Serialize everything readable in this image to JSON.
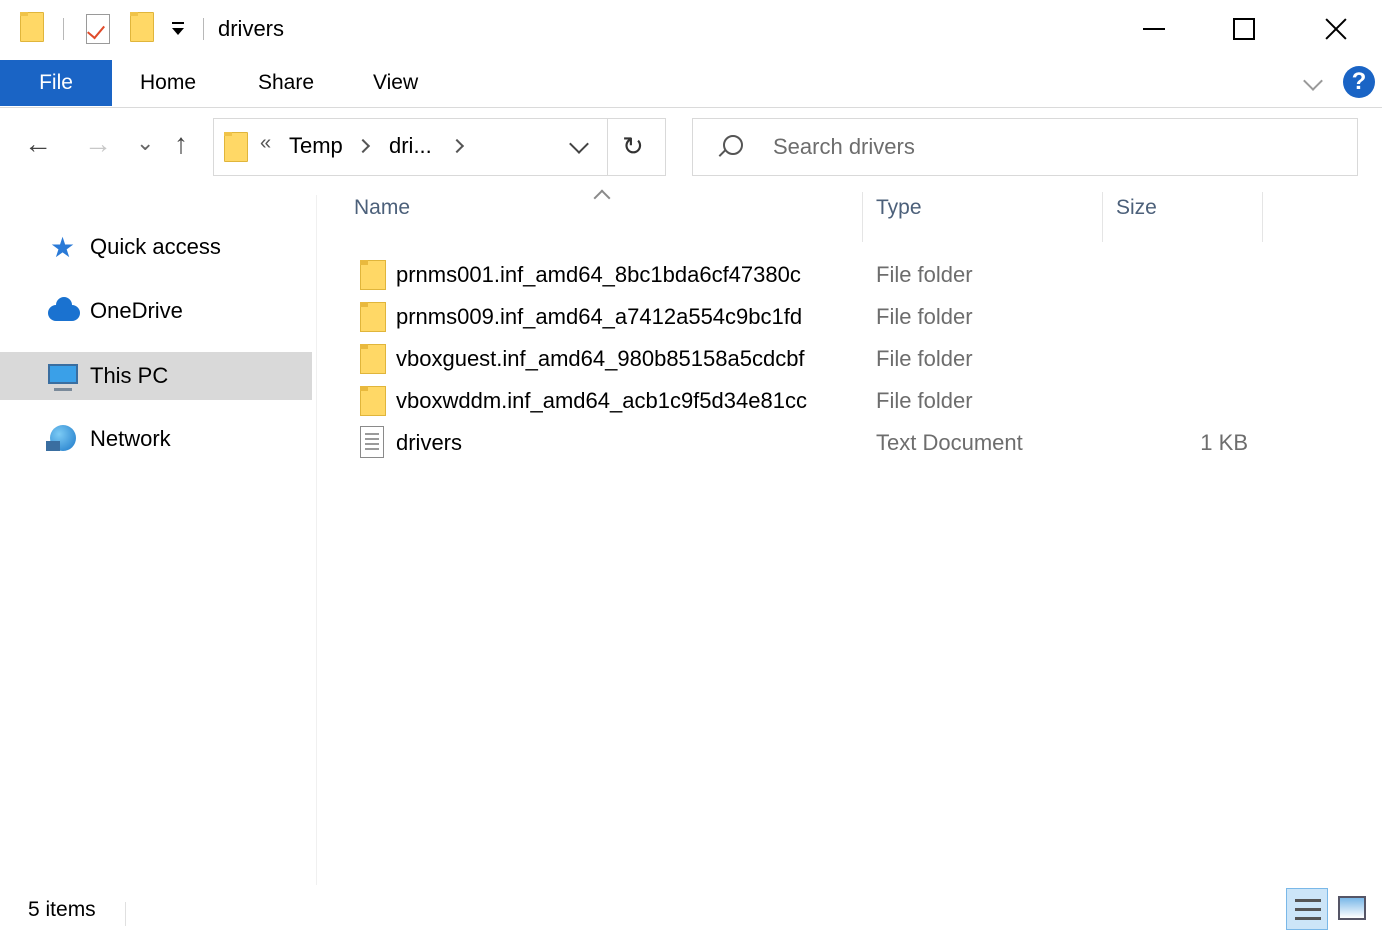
{
  "window": {
    "title": "drivers"
  },
  "ribbon": {
    "tabs": [
      "File",
      "Home",
      "Share",
      "View"
    ],
    "help_label": "?"
  },
  "address": {
    "overflow": "«",
    "segments": [
      "Temp",
      "dri..."
    ],
    "refresh_glyph": "↻"
  },
  "nav_buttons": {
    "back": "←",
    "forward": "→",
    "recent": "⌄",
    "up": "↑"
  },
  "search": {
    "placeholder": "Search drivers"
  },
  "navpane": {
    "items": [
      {
        "label": "Quick access",
        "icon": "star-icon",
        "selected": false
      },
      {
        "label": "OneDrive",
        "icon": "cloud-icon",
        "selected": false
      },
      {
        "label": "This PC",
        "icon": "computer-icon",
        "selected": true
      },
      {
        "label": "Network",
        "icon": "network-icon",
        "selected": false
      }
    ]
  },
  "columns": {
    "name": "Name",
    "type": "Type",
    "size": "Size"
  },
  "files": [
    {
      "name": "prnms001.inf_amd64_8bc1bda6cf47380c",
      "type": "File folder",
      "size": "",
      "icon": "folder-icon"
    },
    {
      "name": "prnms009.inf_amd64_a7412a554c9bc1fd",
      "type": "File folder",
      "size": "",
      "icon": "folder-icon"
    },
    {
      "name": "vboxguest.inf_amd64_980b85158a5cdcbf",
      "type": "File folder",
      "size": "",
      "icon": "folder-icon"
    },
    {
      "name": "vboxwddm.inf_amd64_acb1c9f5d34e81cc",
      "type": "File folder",
      "size": "",
      "icon": "folder-icon"
    },
    {
      "name": "drivers",
      "type": "Text Document",
      "size": "1 KB",
      "icon": "text-document-icon"
    }
  ],
  "status": {
    "item_count": "5 items"
  },
  "colors": {
    "accent": "#1a64c5",
    "selection": "#d9d9d9",
    "folder": "#ffd866"
  }
}
